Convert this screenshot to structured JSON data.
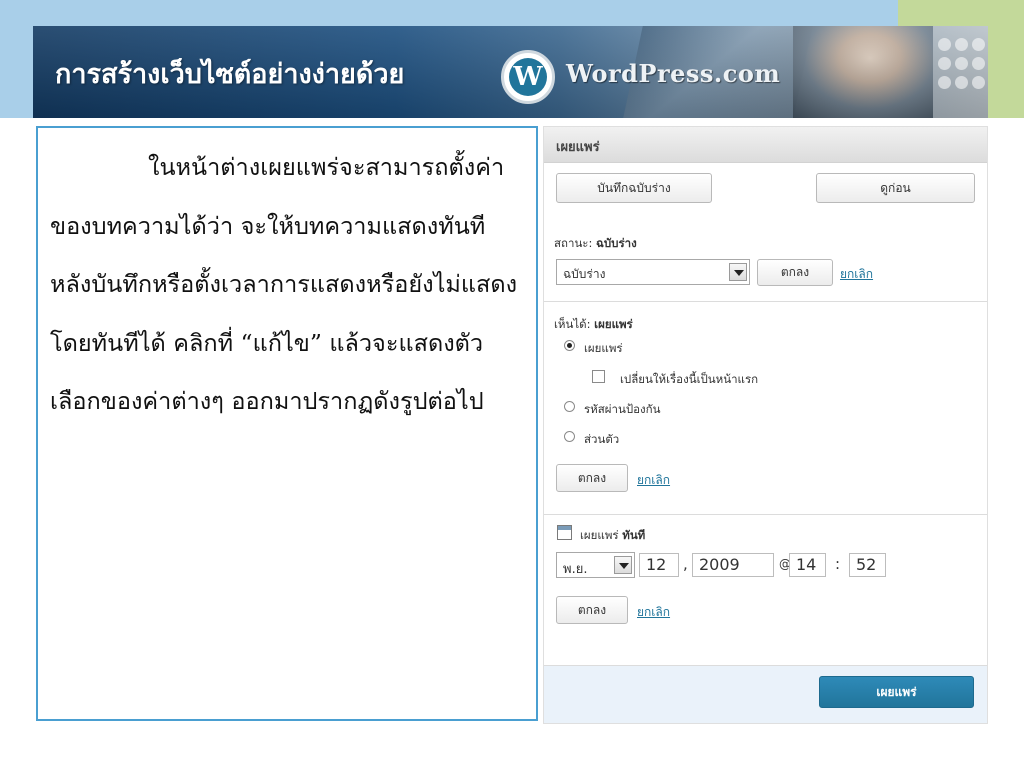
{
  "banner": {
    "title": "การสร้างเว็บไซต์อย่างง่ายด้วย",
    "logo_letter": "W",
    "brand": "WordPress.com"
  },
  "description": {
    "text": "ในหน้าต่างเผยแพร่จะสามารถตั้งค่าของบทความได้ว่า จะให้บทความแสดงทันทีหลังบันทึกหรือตั้งเวลาการแสดงหรือยังไม่แสดงโดยทันทีได้ คลิกที่ “แก้ไข” แล้วจะแสดงตัวเลือกของค่าต่างๆ ออกมาปรากฏดังรูปต่อไป"
  },
  "panel": {
    "title": "เผยแพร่",
    "save_draft_label": "บันทึกฉบับร่าง",
    "preview_label": "ดูก่อน",
    "status": {
      "label": "สถานะ:",
      "value": "ฉบับร่าง",
      "select_value": "ฉบับร่าง",
      "ok_label": "ตกลง",
      "cancel_label": "ยกเลิก"
    },
    "visibility": {
      "label": "เห็นได้:",
      "value": "เผยแพร่",
      "options": {
        "public": "เผยแพร่",
        "sticky": "เปลี่ยนให้เรื่องนี้เป็นหน้าแรก",
        "password": "รหัสผ่านป้องกัน",
        "private": "ส่วนตัว"
      },
      "ok_label": "ตกลง",
      "cancel_label": "ยกเลิก"
    },
    "schedule": {
      "label": "เผยแพร่",
      "value": "ทันที",
      "month": "พ.ย.",
      "day": "12",
      "comma": ",",
      "year": "2009",
      "at": "@",
      "hour": "14",
      "colon": ":",
      "minute": "52",
      "ok_label": "ตกลง",
      "cancel_label": "ยกเลิก"
    },
    "publish_label": "เผยแพร่"
  }
}
